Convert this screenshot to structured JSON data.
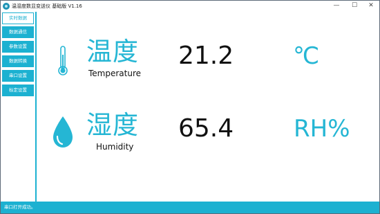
{
  "window": {
    "title": "温湿度数显变送仪 基础版 V1.16",
    "minimize_glyph": "—",
    "maximize_glyph": "☐",
    "close_glyph": "✕"
  },
  "sidebar": {
    "items": [
      {
        "label": "实时数据",
        "active": true
      },
      {
        "label": "数据通信",
        "active": false
      },
      {
        "label": "参数设置",
        "active": false
      },
      {
        "label": "数据转换",
        "active": false
      },
      {
        "label": "串口设置",
        "active": false
      },
      {
        "label": "标定设置",
        "active": false
      }
    ]
  },
  "readings": {
    "temperature": {
      "label_cn": "温度",
      "label_en": "Temperature",
      "value": "21.2",
      "unit": "℃",
      "icon": "thermometer-icon"
    },
    "humidity": {
      "label_cn": "湿度",
      "label_en": "Humidity",
      "value": "65.4",
      "unit": "RH%",
      "icon": "water-drop-icon"
    }
  },
  "status": {
    "text": "串口打开成功。"
  },
  "colors": {
    "accent": "#1cb1d1",
    "label_accent": "#25b6d4",
    "text": "#111111"
  }
}
